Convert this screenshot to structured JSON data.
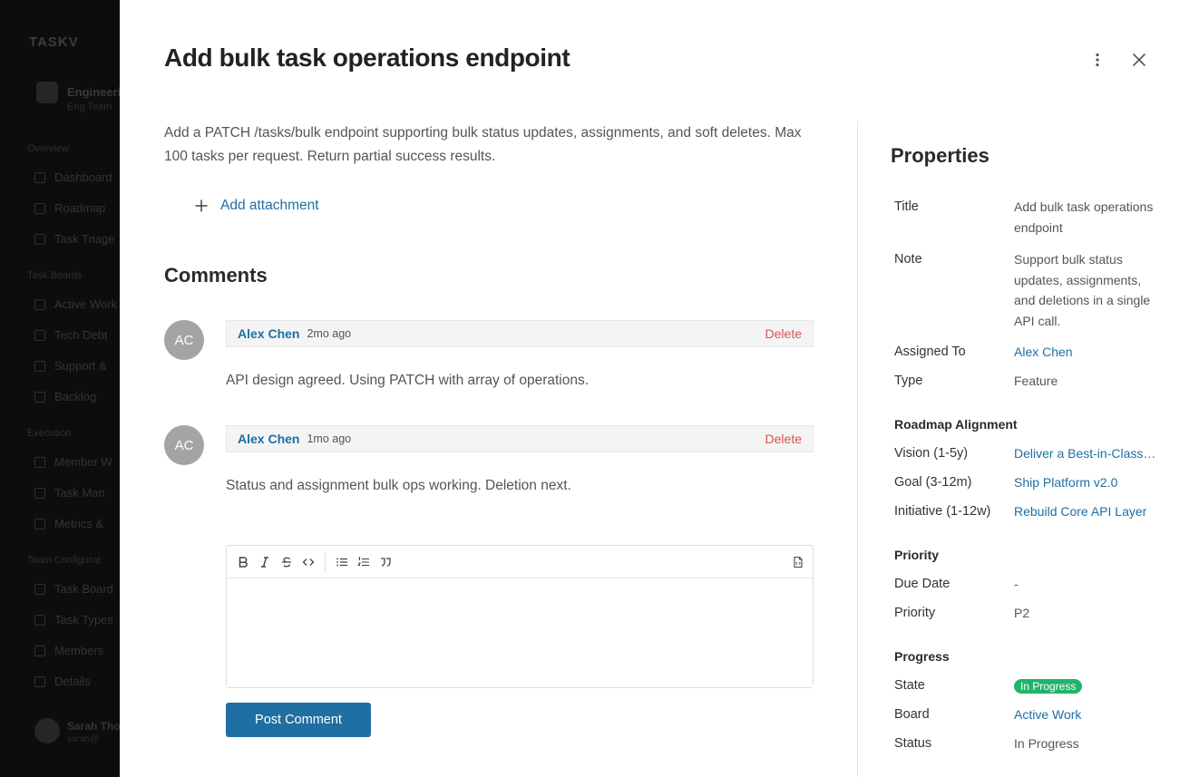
{
  "background": {
    "app_name": "TASKV",
    "team_name": "Engineering",
    "team_sub": "Eng Team",
    "sections": [
      {
        "label": "Overview",
        "items": [
          "Dashboard",
          "Roadmap",
          "Task Triage"
        ]
      },
      {
        "label": "Task Boards",
        "items": [
          "Active Work",
          "Tech Debt",
          "Support &",
          "Backlog"
        ]
      },
      {
        "label": "Execution",
        "items": [
          "Member W",
          "Task Man",
          "Metrics &"
        ]
      },
      {
        "label": "Team Configurat",
        "items": [
          "Task Board",
          "Task Types",
          "Members",
          "Details"
        ]
      }
    ],
    "user_name": "Sarah Tho",
    "user_sub": "sarah@"
  },
  "task": {
    "title": "Add bulk task operations endpoint",
    "description": "Add a PATCH /tasks/bulk endpoint supporting bulk status updates, assignments, and soft deletes. Max 100 tasks per request. Return partial success results.",
    "add_attachment_label": "Add attachment"
  },
  "comments": {
    "title": "Comments",
    "items": [
      {
        "initials": "AC",
        "author": "Alex Chen",
        "when": "2mo ago",
        "delete_label": "Delete",
        "body": "API design agreed. Using PATCH with array of operations."
      },
      {
        "initials": "AC",
        "author": "Alex Chen",
        "when": "1mo ago",
        "delete_label": "Delete",
        "body": "Status and assignment bulk ops working. Deletion next."
      }
    ],
    "editor_value": "",
    "post_label": "Post Comment"
  },
  "properties": {
    "title": "Properties",
    "title_label": "Title",
    "title_value": "Add bulk task operations endpoint",
    "note_label": "Note",
    "note_value": "Support bulk status updates, assignments, and deletions in a single API call.",
    "assigned_label": "Assigned To",
    "assigned_value": "Alex Chen",
    "type_label": "Type",
    "type_value": "Feature",
    "roadmap_section": "Roadmap Alignment",
    "vision_label": "Vision (1-5y)",
    "vision_value": "Deliver a Best-in-Class Platform",
    "goal_label": "Goal (3-12m)",
    "goal_value": "Ship Platform v2.0",
    "initiative_label": "Initiative (1-12w)",
    "initiative_value": "Rebuild Core API Layer",
    "priority_section": "Priority",
    "due_label": "Due Date",
    "due_value": "-",
    "priority_label": "Priority",
    "priority_value": "P2",
    "progress_section": "Progress",
    "state_label": "State",
    "state_value": "In Progress",
    "board_label": "Board",
    "board_value": "Active Work",
    "status_label": "Status",
    "status_value": "In Progress"
  },
  "colors": {
    "link": "#1d6fa5",
    "delete": "#d9534f",
    "badge": "#21b36b",
    "primary_button": "#1f6fa3"
  }
}
